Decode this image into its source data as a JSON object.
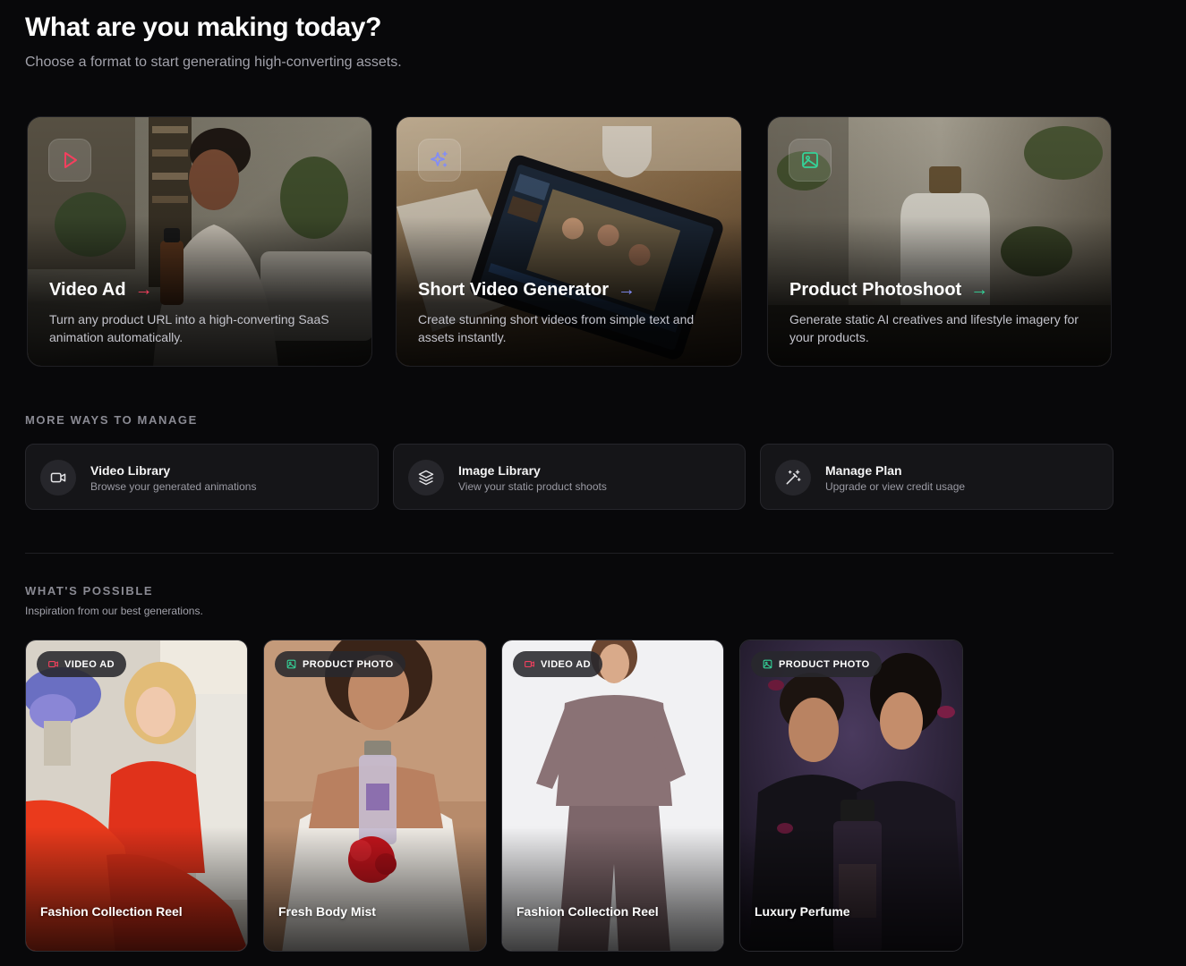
{
  "header": {
    "title": "What are you making today?",
    "subtitle": "Choose a format to start generating high-converting assets."
  },
  "formats": [
    {
      "title": "Video Ad",
      "arrow": "→",
      "description": "Turn any product URL into a high-converting SaaS animation automatically.",
      "icon": "play-icon",
      "accent": "#f43f5e"
    },
    {
      "title": "Short Video Generator",
      "arrow": "→",
      "description": "Create stunning short videos from simple text and assets instantly.",
      "icon": "sparkles-icon",
      "accent": "#818cf8"
    },
    {
      "title": "Product Photoshoot",
      "arrow": "→",
      "description": "Generate static AI creatives and lifestyle imagery for your products.",
      "icon": "image-icon",
      "accent": "#34d399"
    }
  ],
  "manage": {
    "label": "MORE WAYS TO MANAGE",
    "items": [
      {
        "title": "Video Library",
        "description": "Browse your generated animations",
        "icon": "video-camera-icon"
      },
      {
        "title": "Image Library",
        "description": "View your static product shoots",
        "icon": "layers-icon"
      },
      {
        "title": "Manage Plan",
        "description": "Upgrade or view credit usage",
        "icon": "magic-wand-icon"
      }
    ]
  },
  "showcase": {
    "label": "WHAT'S POSSIBLE",
    "subtitle": "Inspiration from our best generations.",
    "items": [
      {
        "badge": "VIDEO AD",
        "badge_icon": "video-camera-icon",
        "badge_color": "#f43f5e",
        "title": "Fashion Collection Reel"
      },
      {
        "badge": "PRODUCT PHOTO",
        "badge_icon": "image-icon",
        "badge_color": "#34d399",
        "title": "Fresh Body Mist"
      },
      {
        "badge": "VIDEO AD",
        "badge_icon": "video-camera-icon",
        "badge_color": "#f43f5e",
        "title": "Fashion Collection Reel"
      },
      {
        "badge": "PRODUCT PHOTO",
        "badge_icon": "image-icon",
        "badge_color": "#34d399",
        "title": "Luxury Perfume"
      }
    ]
  }
}
